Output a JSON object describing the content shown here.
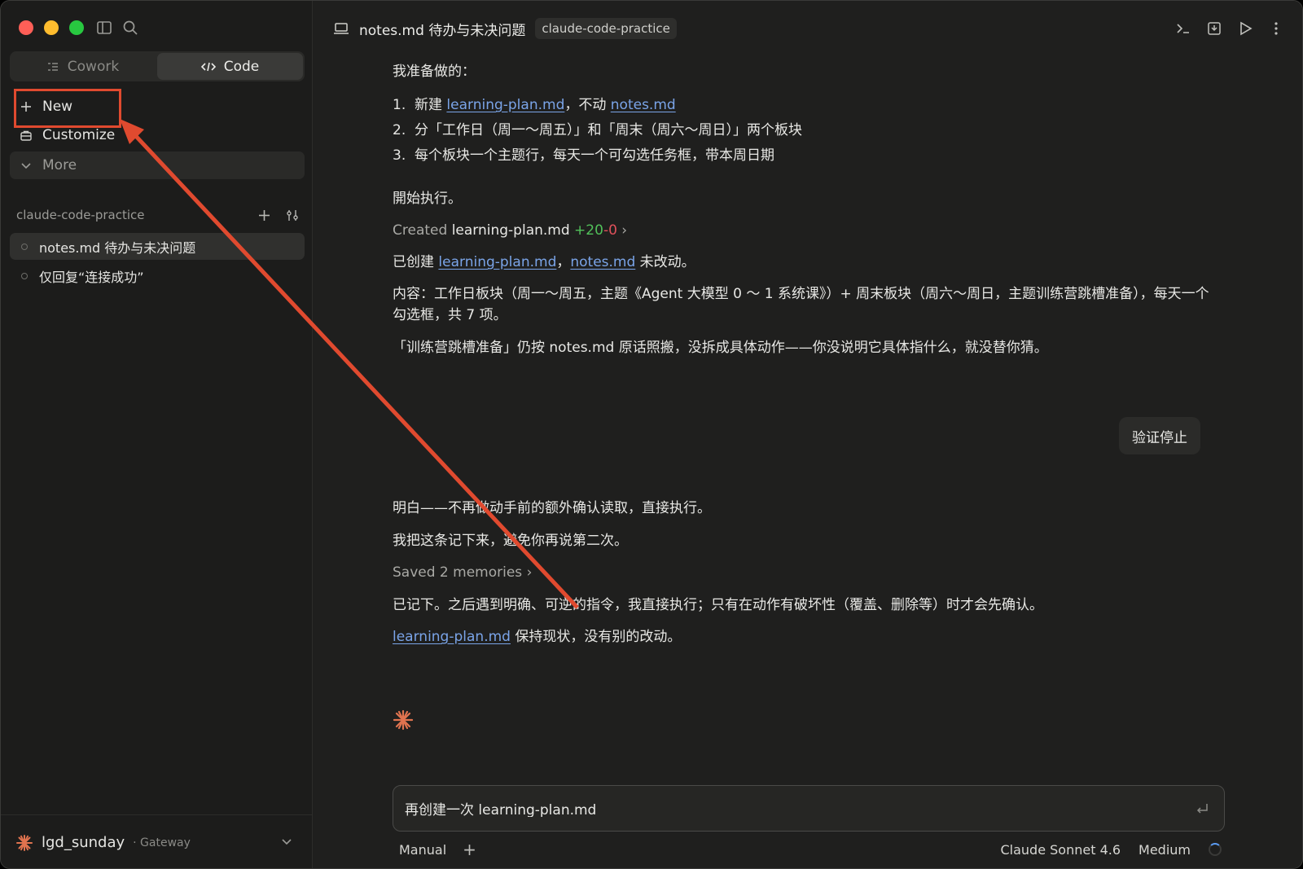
{
  "sidebar": {
    "modes": [
      {
        "label": "Cowork",
        "active": false
      },
      {
        "label": "Code",
        "active": true
      }
    ],
    "nav": {
      "new_label": "New",
      "customize_label": "Customize",
      "more_label": "More"
    },
    "project": {
      "name": "claude-code-practice",
      "threads": [
        {
          "label": "notes.md 待办与未决问题",
          "active": true
        },
        {
          "label": "仅回复“连接成功”",
          "active": false
        }
      ]
    },
    "user": {
      "name": "lgd_sunday",
      "sub": "· Gateway"
    }
  },
  "header": {
    "title": "notes.md 待办与未决问题",
    "tag": "claude-code-practice"
  },
  "messages": {
    "plan_intro": "我准备做的：",
    "plan_items": [
      {
        "num": "1.",
        "pre": "新建 ",
        "link1": "learning-plan.md",
        "mid": "，不动 ",
        "link2": "notes.md"
      },
      {
        "num": "2.",
        "text": "分「工作日（周一～周五）」和「周末（周六～周日）」两个板块"
      },
      {
        "num": "3.",
        "text": "每个板块一个主题行，每天一个可勾选任务框，带本周日期"
      }
    ],
    "start": "開始执行。",
    "created": {
      "label": "Created",
      "file": "learning-plan.md",
      "added": "+20",
      "removed": "-0"
    },
    "created_note": {
      "pre": "已创建 ",
      "link1": "learning-plan.md",
      "sep": "，",
      "link2": "notes.md",
      "post": " 未改动。"
    },
    "content_desc": "内容：工作日板块（周一～周五，主题《Agent 大模型 0 ～ 1 系统课》）+ 周末板块（周六～周日，主题训练营跳槽准备），每天一个勾选框，共 7 项。",
    "training_note": "「训练营跳槽准备」仍按 notes.md 原话照搬，没拆成具体动作——你没说明它具体指什么，就没替你猜。",
    "user_msg": "验证停止",
    "reply1": "明白——不再做动手前的额外确认读取，直接执行。",
    "reply2": "我把这条记下来，避免你再说第二次。",
    "saved": "Saved 2 memories",
    "reply3": "已记下。之后遇到明确、可逆的指令，我直接执行；只有在动作有破坏性（覆盖、删除等）时才会先确认。",
    "reply4": {
      "link": "learning-plan.md",
      "text": " 保持现状，没有别的改动。"
    }
  },
  "composer": {
    "value": "再创建一次 learning-plan.md",
    "mode": "Manual",
    "model": "Claude Sonnet 4.6",
    "effort": "Medium"
  },
  "colors": {
    "accent_link": "#7aa4e8",
    "diff_added": "#51c05a",
    "diff_removed": "#e0515b",
    "annotation": "#e04a2f",
    "spark": "#e0734f"
  },
  "icons": [
    "search-icon",
    "sidebar-toggle-icon",
    "terminal-icon",
    "export-icon",
    "play-icon",
    "kebab-icon",
    "spark-icon",
    "enter-icon"
  ]
}
